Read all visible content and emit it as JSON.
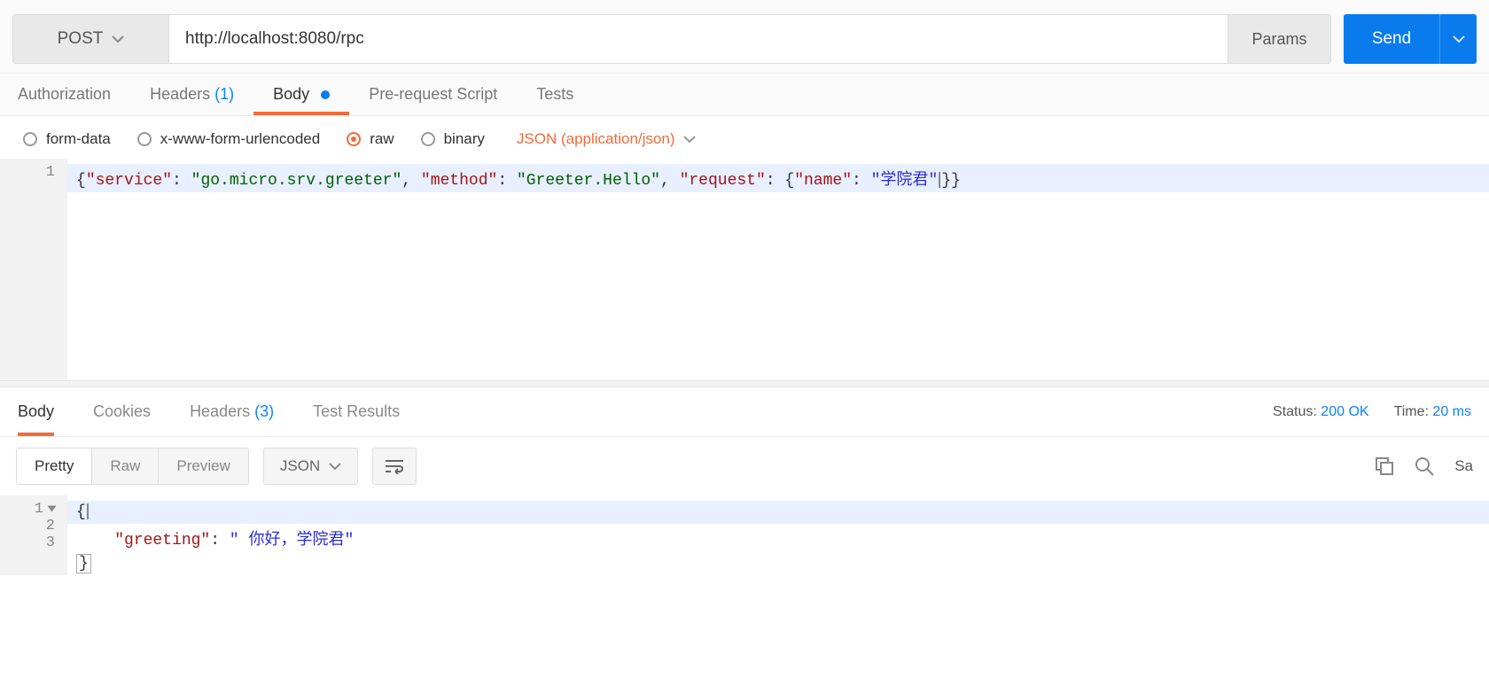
{
  "request": {
    "method": "POST",
    "url": "http://localhost:8080/rpc",
    "params_label": "Params",
    "send_label": "Send"
  },
  "request_tabs": {
    "authorization": "Authorization",
    "headers": "Headers",
    "headers_count": "(1)",
    "body": "Body",
    "prerequest": "Pre-request Script",
    "tests": "Tests"
  },
  "body_types": {
    "form_data": "form-data",
    "urlencoded": "x-www-form-urlencoded",
    "raw": "raw",
    "binary": "binary",
    "content_type": "JSON (application/json)"
  },
  "request_body": {
    "line": "1",
    "tokens": {
      "open": "{",
      "sep": ": ",
      "comma": ", ",
      "k1": "\"service\"",
      "v1": "\"go.micro.srv.greeter\"",
      "k2": "\"method\"",
      "v2": "\"Greeter.Hello\"",
      "k3": "\"request\"",
      "open2": "{",
      "k4": "\"name\"",
      "v4": "\"学院君\"",
      "close": "}}"
    }
  },
  "response_tabs": {
    "body": "Body",
    "cookies": "Cookies",
    "headers": "Headers",
    "headers_count": "(3)",
    "tests": "Test Results"
  },
  "response_meta": {
    "status_label": "Status:",
    "status_value": "200 OK",
    "time_label": "Time:",
    "time_value": "20 ms"
  },
  "response_toolbar": {
    "pretty": "Pretty",
    "raw": "Raw",
    "preview": "Preview",
    "format": "JSON",
    "save": "Sa"
  },
  "response_body": {
    "l1": "1",
    "l2": "2",
    "l3": "3",
    "open": "{",
    "indent": "    ",
    "k1": "\"greeting\"",
    "sep": ": ",
    "v1": "\" 你好，学院君\"",
    "close": "}"
  }
}
